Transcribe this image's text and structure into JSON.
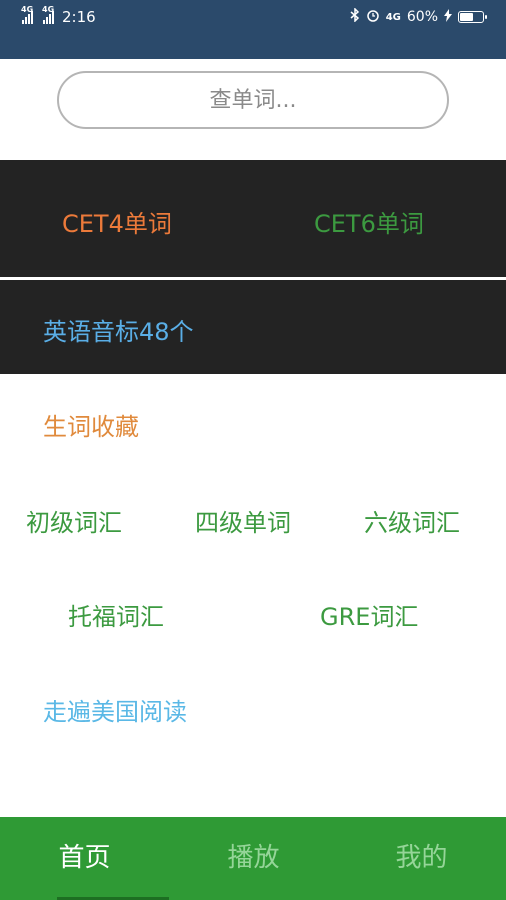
{
  "status_bar": {
    "signal1": "4G",
    "signal2": "4G",
    "time": "2:16",
    "network": "4G",
    "battery": "60%",
    "battery_level": 0.6
  },
  "search": {
    "placeholder": "查单词..."
  },
  "categories_top": {
    "cet4": "CET4单词",
    "cet6": "CET6单词"
  },
  "phonetics": {
    "label": "英语音标48个"
  },
  "menu": {
    "favorites": "生词收藏",
    "basic": "初级词汇",
    "level4": "四级单词",
    "level6": "六级词汇",
    "toefl": "托福词汇",
    "gre": "GRE词汇",
    "reading": "走遍美国阅读"
  },
  "nav": {
    "home": "首页",
    "play": "播放",
    "mine": "我的"
  },
  "colors": {
    "status_bar": "#2b4a6b",
    "dark_band": "#232323",
    "orange": "#ec7a3a",
    "green": "#3c9a40",
    "blue": "#5aaee6",
    "nav_green": "#2f9a35"
  }
}
